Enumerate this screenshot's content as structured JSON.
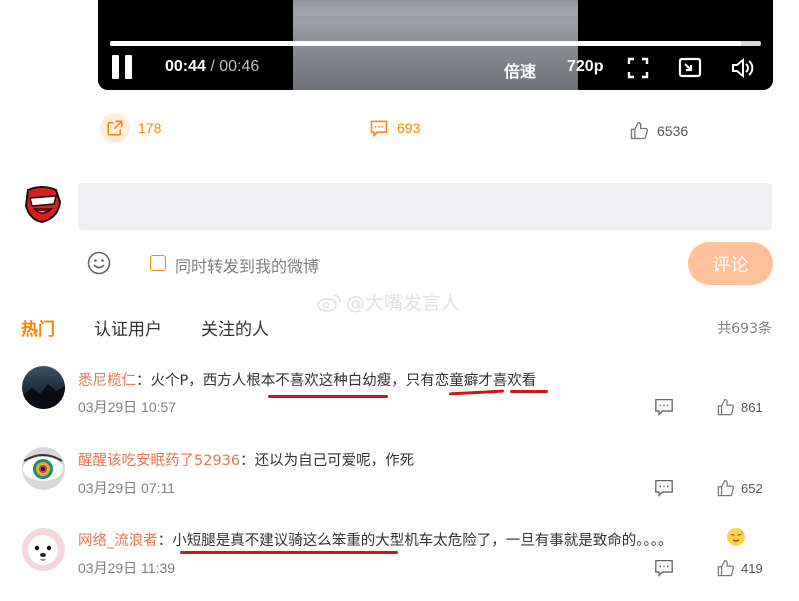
{
  "player": {
    "current_time": "00:44",
    "separator": "/",
    "duration": "00:46",
    "progress_fraction": 0.97,
    "speed_label": "倍速",
    "quality_label": "720p"
  },
  "actions": {
    "repost_count": "178",
    "comment_count": "693",
    "like_count": "6536"
  },
  "composer": {
    "forward_label": "同时转发到我的微博",
    "submit_label": "评论"
  },
  "watermark": "@大嘴发言人",
  "tabs": {
    "hot": "热门",
    "verified": "认证用户",
    "following": "关注的人",
    "total": "共693条"
  },
  "comments": [
    {
      "user": "悉尼榄仁",
      "text": "：火个P，西方人根本不喜欢这种白幼瘦，只有恋童癖才喜欢看",
      "time": "03月29日 10:57",
      "likes": "861"
    },
    {
      "user": "醒醒该吃安眠药了52936",
      "text": "：还以为自己可爱呢，作死",
      "time": "03月29日 07:11",
      "likes": "652"
    },
    {
      "user": "网络_流浪者",
      "text": "：小短腿是真不建议骑这么笨重的大型机车太危险了，一旦有事就是致命的。。。。",
      "time": "03月29日 11:39",
      "likes": "419"
    }
  ],
  "colors": {
    "accent": "#ff8200",
    "username": "#eb7350",
    "underline": "#d0151a",
    "submit_disabled": "#ffc09a"
  }
}
